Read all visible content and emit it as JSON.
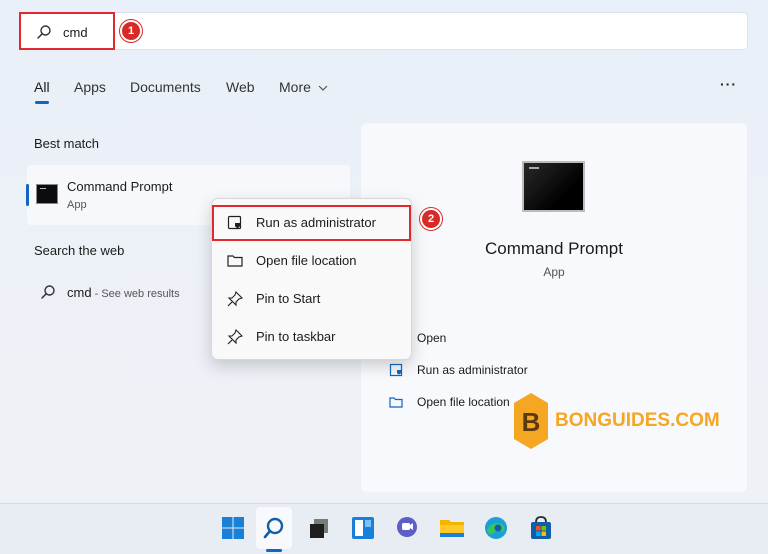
{
  "search": {
    "query": "cmd",
    "marker_1": "1"
  },
  "tabs": [
    {
      "label": "All",
      "active": true
    },
    {
      "label": "Apps"
    },
    {
      "label": "Documents"
    },
    {
      "label": "Web"
    },
    {
      "label": "More"
    }
  ],
  "more_menu_label": "···",
  "left": {
    "best_match_title": "Best match",
    "best_match": {
      "title": "Command Prompt",
      "subtitle": "App"
    },
    "search_web_title": "Search the web",
    "web_result": {
      "query": "cmd",
      "suffix": " - See web results"
    }
  },
  "context_menu": {
    "marker_2": "2",
    "items": [
      {
        "label": "Run as administrator",
        "icon": "shield-icon"
      },
      {
        "label": "Open file location",
        "icon": "folder-icon"
      },
      {
        "label": "Pin to Start",
        "icon": "pin-icon"
      },
      {
        "label": "Pin to taskbar",
        "icon": "pin-icon"
      }
    ]
  },
  "right_panel": {
    "title": "Command Prompt",
    "subtitle": "App",
    "actions": [
      {
        "label": "Open",
        "icon": "open-icon"
      },
      {
        "label": "Run as administrator",
        "icon": "shield-icon"
      },
      {
        "label": "Open file location",
        "icon": "folder-icon"
      }
    ]
  },
  "watermark": {
    "text": "BONGUIDES.COM",
    "logo_letter": "B"
  },
  "taskbar": {
    "icons": [
      "windows-start-icon",
      "search-icon",
      "task-view-icon",
      "widgets-icon",
      "chat-icon",
      "file-explorer-icon",
      "edge-icon",
      "store-icon"
    ]
  },
  "colors": {
    "accent": "#1066c3",
    "highlight": "#e0282e",
    "watermark": "#f5a623"
  }
}
